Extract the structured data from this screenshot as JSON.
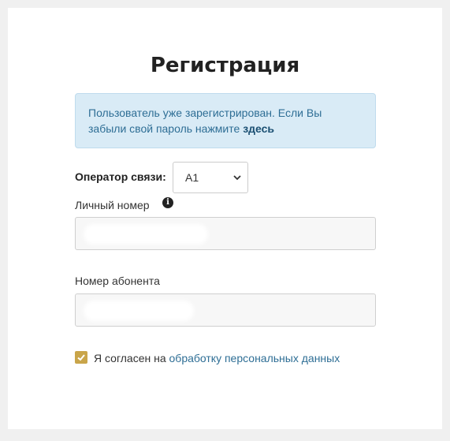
{
  "page": {
    "title": "Регистрация"
  },
  "alert": {
    "text": "Пользователь уже зарегистрирован. Если Вы забыли свой пароль нажмите",
    "link": "здесь"
  },
  "form": {
    "operator_label": "Оператор связи:",
    "operator_value": "A1",
    "personal_number_label": "Личный номер",
    "personal_number_value": "",
    "subscriber_number_label": "Номер абонента",
    "subscriber_number_value": "",
    "consent_checked": true,
    "consent_text": "Я согласен на",
    "consent_link": "обработку персональных данных"
  },
  "colors": {
    "accent_checkbox": "#c9a54a",
    "alert_bg": "#d9ebf6",
    "link": "#2e6e95"
  }
}
